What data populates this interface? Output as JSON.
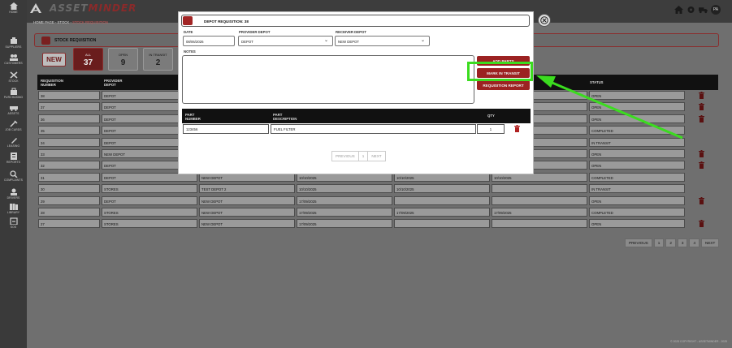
{
  "sidebar": {
    "items": [
      {
        "label": "Home",
        "icon": "home-icon"
      },
      {
        "label": "Suppliers",
        "icon": "suppliers-icon"
      },
      {
        "label": "Customers",
        "icon": "customers-icon"
      },
      {
        "label": "Stock",
        "icon": "stock-icon"
      },
      {
        "label": "Purchasing",
        "icon": "purchasing-icon"
      },
      {
        "label": "Assets",
        "icon": "assets-icon"
      },
      {
        "label": "Job Cards",
        "icon": "job-cards-icon"
      },
      {
        "label": "Leasing",
        "icon": "leasing-icon"
      },
      {
        "label": "Reports",
        "icon": "reports-icon"
      },
      {
        "label": "Complaints",
        "icon": "complaints-icon"
      },
      {
        "label": "Drivers",
        "icon": "drivers-icon"
      },
      {
        "label": "Library",
        "icon": "library-icon"
      },
      {
        "label": "SOS",
        "icon": "sos-icon"
      }
    ]
  },
  "header": {
    "logo_part1": "ASSET",
    "logo_part2": "MINDER",
    "avatar_initials": "PA"
  },
  "breadcrumb": {
    "home": "HOME PAGE",
    "sep1": " - ",
    "section": "STOCK",
    "sep2": " - ",
    "current": "STOCK REQUISITION"
  },
  "page": {
    "title": "STOCK REQUISITION",
    "new_label": "NEW",
    "filters": [
      {
        "label": "ALL",
        "count": "37"
      },
      {
        "label": "OPEN",
        "count": "9"
      },
      {
        "label": "IN TRANSIT",
        "count": "2"
      }
    ]
  },
  "table": {
    "headers": {
      "req_number_1": "REQUISITION",
      "req_number_2": "NUMBER",
      "provider_1": "PROVIDER",
      "provider_2": "DEPOT",
      "status": "STATUS"
    },
    "rows": [
      {
        "num": "38",
        "provider": "DEPOT",
        "receiver": "",
        "date1": "",
        "date2": "",
        "date3": "",
        "status": "OPEN",
        "trash": true
      },
      {
        "num": "37",
        "provider": "DEPOT",
        "receiver": "",
        "date1": "",
        "date2": "",
        "date3": "",
        "status": "OPEN",
        "trash": true
      },
      {
        "num": "36",
        "provider": "DEPOT",
        "receiver": "",
        "date1": "",
        "date2": "",
        "date3": "",
        "status": "OPEN",
        "trash": true
      },
      {
        "num": "35",
        "provider": "DEPOT",
        "receiver": "",
        "date1": "",
        "date2": "",
        "date3": "",
        "status": "COMPLETED",
        "trash": false
      },
      {
        "num": "34",
        "provider": "DEPOT",
        "receiver": "",
        "date1": "",
        "date2": "",
        "date3": "",
        "status": "IN TRANSIT",
        "trash": false
      },
      {
        "num": "33",
        "provider": "NEW DEPOT",
        "receiver": "",
        "date1": "",
        "date2": "",
        "date3": "",
        "status": "OPEN",
        "trash": true
      },
      {
        "num": "32",
        "provider": "DEPOT",
        "receiver": "",
        "date1": "",
        "date2": "",
        "date3": "",
        "status": "OPEN",
        "trash": true
      },
      {
        "num": "31",
        "provider": "DEPOT",
        "receiver": "NEW DEPOT",
        "date1": "10/10/2025",
        "date2": "10/10/2025",
        "date3": "10/10/2025",
        "status": "COMPLETED",
        "trash": false
      },
      {
        "num": "30",
        "provider": "STORES",
        "receiver": "TEST DEPOT 2",
        "date1": "10/10/2025",
        "date2": "10/10/2025",
        "date3": "",
        "status": "IN TRANSIT",
        "trash": false
      },
      {
        "num": "29",
        "provider": "DEPOT",
        "receiver": "NEW DEPOT",
        "date1": "17/09/2025",
        "date2": "",
        "date3": "",
        "status": "OPEN",
        "trash": true
      },
      {
        "num": "28",
        "provider": "STORES",
        "receiver": "NEW DEPOT",
        "date1": "17/09/2025",
        "date2": "17/09/2025",
        "date3": "17/09/2025",
        "status": "COMPLETED",
        "trash": false
      },
      {
        "num": "27",
        "provider": "STORES",
        "receiver": "NEW DEPOT",
        "date1": "17/09/2025",
        "date2": "",
        "date3": "",
        "status": "OPEN",
        "trash": true
      }
    ]
  },
  "pager": {
    "previous": "PREVIOUS",
    "pages": [
      "1",
      "2",
      "3",
      "4"
    ],
    "next": "NEXT"
  },
  "modal": {
    "title": "DEPOT REQUISITION: 38",
    "date_label": "DATE",
    "date_value": "08/06/2026",
    "provider_label": "PROVIDER DEPOT",
    "provider_value": "DEPOT",
    "receiver_label": "RECEIVER DEPOT",
    "receiver_value": "NEW DEPOT",
    "notes_label": "NOTES",
    "notes_value": "",
    "add_parts": "ADD PARTS",
    "mark_in_transit": "MARK IN TRANSIT",
    "requisition_report": "REQUISITION REPORT",
    "parts_headers": {
      "part_number_1": "PART",
      "part_number_2": "NUMBER",
      "part_desc_1": "PART",
      "part_desc_2": "DESCRIPTION",
      "qty": "QTY"
    },
    "parts": [
      {
        "number": "123456",
        "description": "FUEL FILTER",
        "qty": "1"
      }
    ],
    "pager": {
      "previous": "PREVIOUS",
      "page": "1",
      "next": "NEXT"
    }
  },
  "footer": {
    "text": "© 2025 COPYRIGHT - ASSETMINDER - 2025"
  },
  "colors": {
    "accent": "#9c2222",
    "highlight": "#3bdc1f"
  }
}
